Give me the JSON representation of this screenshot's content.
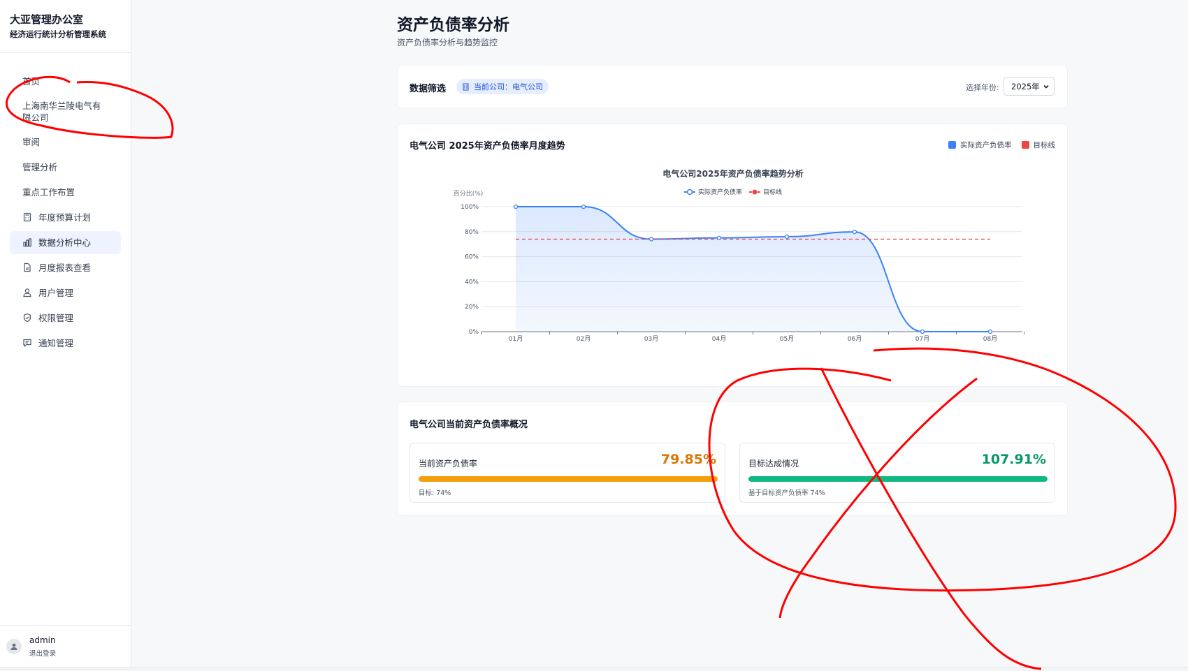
{
  "sidebar": {
    "brand_title": "大亚管理办公室",
    "brand_subtitle": "经济运行统计分析管理系统",
    "items": [
      {
        "label": "首页",
        "icon": ""
      },
      {
        "label": "上海南华兰陵电气有限公司",
        "icon": ""
      },
      {
        "label": "审阅",
        "icon": ""
      },
      {
        "label": "管理分析",
        "icon": ""
      },
      {
        "label": "重点工作布置",
        "icon": ""
      },
      {
        "label": "年度预算计划",
        "icon": "calculator-icon"
      },
      {
        "label": "数据分析中心",
        "icon": "bar-chart-icon",
        "active": true
      },
      {
        "label": "月度报表查看",
        "icon": "document-icon"
      },
      {
        "label": "用户管理",
        "icon": "users-icon"
      },
      {
        "label": "权限管理",
        "icon": "shield-icon"
      },
      {
        "label": "通知管理",
        "icon": "message-icon"
      }
    ],
    "user": {
      "name": "admin",
      "logout_label": "退出登录",
      "icon": "user-icon"
    }
  },
  "header": {
    "title": "资产负债率分析",
    "subtitle": "资产负债率分析与趋势监控"
  },
  "filter": {
    "title": "数据筛选",
    "company_chip": "当前公司：电气公司",
    "company_icon": "building-icon",
    "year_label": "选择年份:",
    "year_value": "2025年"
  },
  "trend_card": {
    "title": "电气公司 2025年资产负债率月度趋势",
    "legend": [
      {
        "label": "实际资产负债率",
        "color": "#3b82f6"
      },
      {
        "label": "目标线",
        "color": "#ef4444"
      }
    ]
  },
  "chart_data": {
    "type": "line",
    "title": "电气公司2025年资产负债率趋势分析",
    "ylabel": "百分比(%)",
    "xlabel": "",
    "categories": [
      "01月",
      "02月",
      "03月",
      "04月",
      "05月",
      "06月",
      "07月",
      "08月"
    ],
    "yticks": [
      "0%",
      "20%",
      "40%",
      "60%",
      "80%",
      "100%"
    ],
    "ylim": [
      0,
      100
    ],
    "grid": true,
    "legend_position": "top-center",
    "series": [
      {
        "name": "实际资产负债率",
        "values": [
          100,
          100,
          74,
          75,
          76,
          79.85,
          0,
          0
        ],
        "color": "#3b82f6",
        "area": true
      },
      {
        "name": "目标线",
        "values": [
          74,
          74,
          74,
          74,
          74,
          74,
          74,
          74
        ],
        "color": "#ef4444",
        "dashed": true
      }
    ]
  },
  "overview": {
    "title": "电气公司当前资产负债率概况",
    "current": {
      "label": "当前资产负债率",
      "value": "79.85%",
      "progress": 1.0,
      "note": "目标: 74%",
      "color": "#f59e0b",
      "value_color": "#d97706"
    },
    "target": {
      "label": "目标达成情况",
      "value": "107.91%",
      "progress": 1.0,
      "note": "基于目标资产负债率 74%",
      "color": "#10b981",
      "value_color": "#059669"
    }
  },
  "annotation_color": "#ff0000"
}
